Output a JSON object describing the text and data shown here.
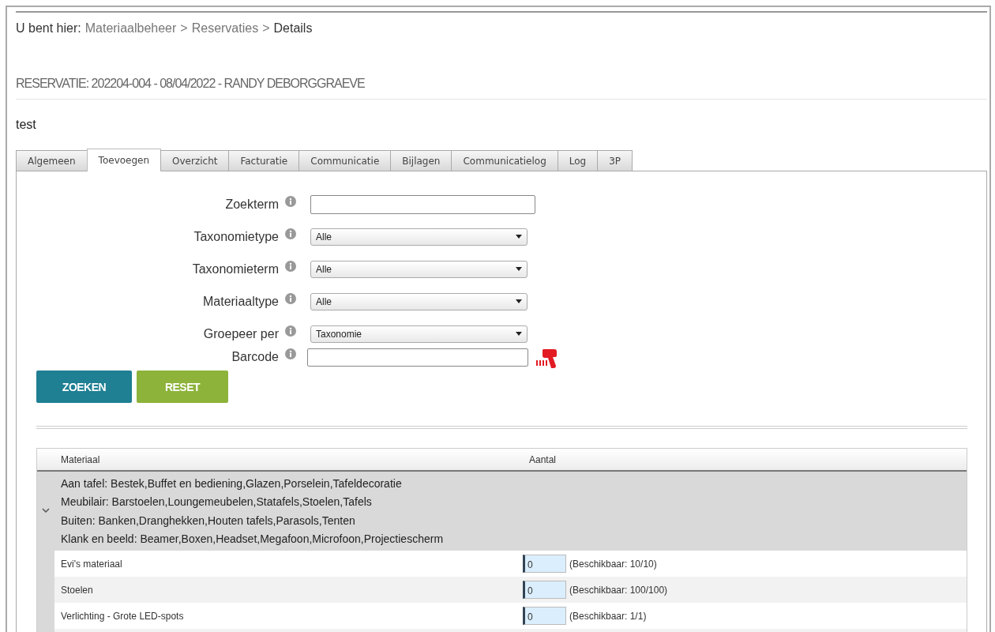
{
  "breadcrumb": {
    "label": "U bent hier:",
    "separator": ">",
    "items": [
      {
        "text": "Materiaalbeheer",
        "current": false
      },
      {
        "text": "Reservaties",
        "current": false
      },
      {
        "text": "Details",
        "current": true
      }
    ]
  },
  "heading": "RESERVATIE: 202204-004 - 08/04/2022 - RANDY DEBORGGRAEVE",
  "description": "test",
  "tabs": [
    {
      "label": "Algemeen",
      "selected": false
    },
    {
      "label": "Toevoegen",
      "selected": true
    },
    {
      "label": "Overzicht",
      "selected": false
    },
    {
      "label": "Facturatie",
      "selected": false
    },
    {
      "label": "Communicatie",
      "selected": false
    },
    {
      "label": "Bijlagen",
      "selected": false
    },
    {
      "label": "Communicatielog",
      "selected": false
    },
    {
      "label": "Log",
      "selected": false
    },
    {
      "label": "3P",
      "selected": false
    }
  ],
  "form": {
    "fields": [
      {
        "kind": "text",
        "label": "Zoekterm"
      },
      {
        "kind": "select",
        "label": "Taxonomietype",
        "value": "Alle"
      },
      {
        "kind": "select",
        "label": "Taxonomieterm",
        "value": "Alle"
      },
      {
        "kind": "select",
        "label": "Materiaaltype",
        "value": "Alle"
      },
      {
        "kind": "select",
        "label": "Groepeer per",
        "value": "Taxonomie"
      },
      {
        "kind": "barcode",
        "label": "Barcode"
      }
    ],
    "buttons": [
      {
        "label": "ZOEKEN",
        "kind": "primary"
      },
      {
        "label": "RESET",
        "kind": "secondary"
      }
    ]
  },
  "table": {
    "columns": [
      "Materiaal",
      "Aantal"
    ],
    "group": {
      "expanded": true,
      "lines": [
        "Aan tafel: Bestek,Buffet en bediening,Glazen,Porselein,Tafeldecoratie",
        "Meubilair: Barstoelen,Loungemeubelen,Statafels,Stoelen,Tafels",
        "Buiten: Banken,Dranghekken,Houten tafels,Parasols,Tenten",
        "Klank en beeld: Beamer,Boxen,Headset,Megafoon,Microfoon,Projectiescherm"
      ]
    },
    "rows": [
      {
        "name": "Evi's materiaal",
        "quantity": "0",
        "availability": "(Beschikbaar: 10/10)"
      },
      {
        "name": "Stoelen",
        "quantity": "0",
        "availability": "(Beschikbaar: 100/100)"
      },
      {
        "name": "Verlichting - Grote LED-spots",
        "quantity": "0",
        "availability": "(Beschikbaar: 1/1)"
      }
    ]
  }
}
